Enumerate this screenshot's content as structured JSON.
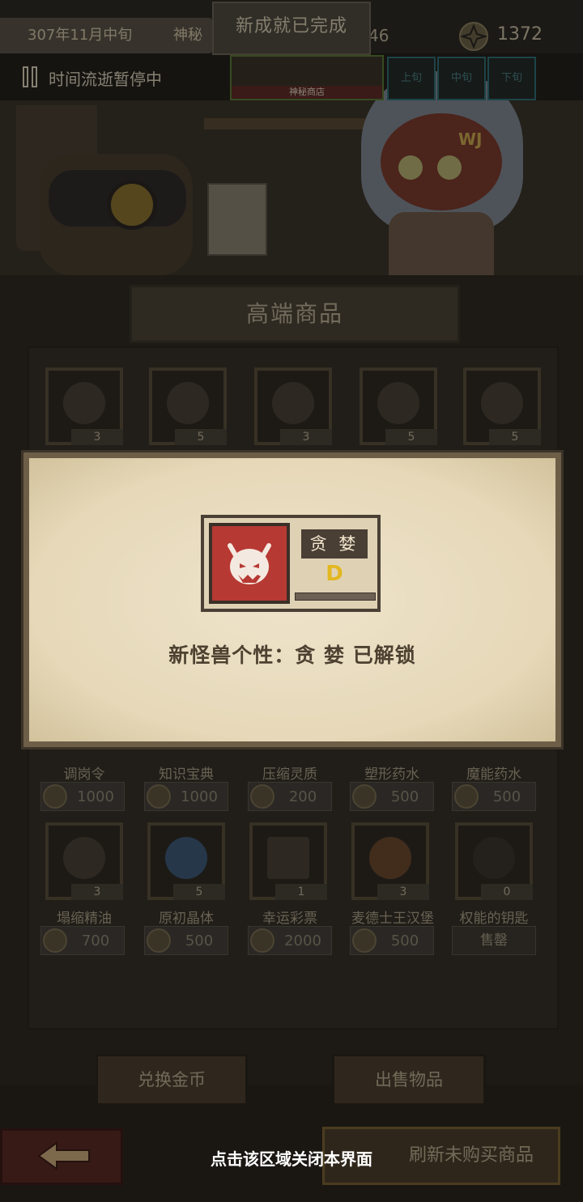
{
  "topbar": {
    "date": "307年11月中旬",
    "place": "神秘商",
    "achievement": "新成就已完成",
    "count": "46",
    "gold": "1372"
  },
  "pausebar": {
    "status": "时间流逝暂停中",
    "map_label": "神秘商店",
    "segments": [
      "上旬",
      "中旬",
      "下旬"
    ]
  },
  "shop": {
    "title": "高端商品",
    "row1": [
      {
        "icon": "eye-orb-icon",
        "qty": "3",
        "name": "调岗令",
        "price": "1000"
      },
      {
        "icon": "cassette-icon",
        "qty": "5",
        "name": "知识宝典",
        "price": "1000"
      },
      {
        "icon": "tome-icon",
        "qty": "3",
        "name": "压缩灵质",
        "price": "200"
      },
      {
        "icon": "crystal-icon",
        "qty": "5",
        "name": "塑形药水",
        "price": "500"
      },
      {
        "icon": "totem-icon",
        "qty": "5",
        "name": "魔能药水",
        "price": "500"
      }
    ],
    "row2": [
      {
        "icon": "oil-bottle-icon",
        "qty": "3",
        "name": "塌缩精油",
        "price": "700"
      },
      {
        "icon": "raw-crystal-icon",
        "qty": "5",
        "name": "原初晶体",
        "price": "500"
      },
      {
        "icon": "lottery-ticket-icon",
        "qty": "1",
        "name": "幸运彩票",
        "price": "2000"
      },
      {
        "icon": "burger-icon",
        "qty": "3",
        "name": "麦德士王汉堡",
        "price": "500"
      },
      {
        "icon": "key-icon",
        "qty": "0",
        "name": "权能的钥匙",
        "soldout": "售罄"
      }
    ]
  },
  "buttons": {
    "exchange": "兑换金币",
    "sell": "出售物品",
    "refresh": "刷新未购买商品"
  },
  "popup": {
    "trait_name": "贪 婪",
    "trait_grade": "D",
    "message": "新怪兽个性：贪 婪 已解锁"
  },
  "close_hint": "点击该区域关闭本界面",
  "colors": {
    "grade": "#e3b720",
    "portrait": "#b73933",
    "parchment": "#eee3cb"
  }
}
